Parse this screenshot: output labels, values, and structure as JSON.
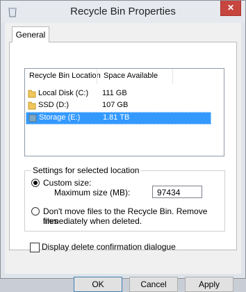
{
  "window": {
    "title": "Recycle Bin Properties",
    "close_label": "✕"
  },
  "tabs": [
    {
      "label": "General"
    }
  ],
  "list": {
    "columns": [
      "Recycle Bin Location",
      "Space Available"
    ],
    "rows": [
      {
        "name": "Local Disk (C:)",
        "space": "111 GB"
      },
      {
        "name": "SSD (D:)",
        "space": "107 GB"
      },
      {
        "name": "Storage (E:)",
        "space": "1.81 TB",
        "selected": true
      }
    ]
  },
  "settings": {
    "group_label": "Settings for selected location",
    "custom_size_label": "Custom size:",
    "max_size_label": "Maximum size (MB):",
    "max_size_value": "97434",
    "dont_move_label_line1": "Don't move files to the Recycle Bin. Remove files",
    "dont_move_label_line2": "immediately when deleted."
  },
  "confirm_checkbox_label": "Display delete confirmation dialogue",
  "buttons": {
    "ok": "OK",
    "cancel": "Cancel",
    "apply": "Apply"
  }
}
